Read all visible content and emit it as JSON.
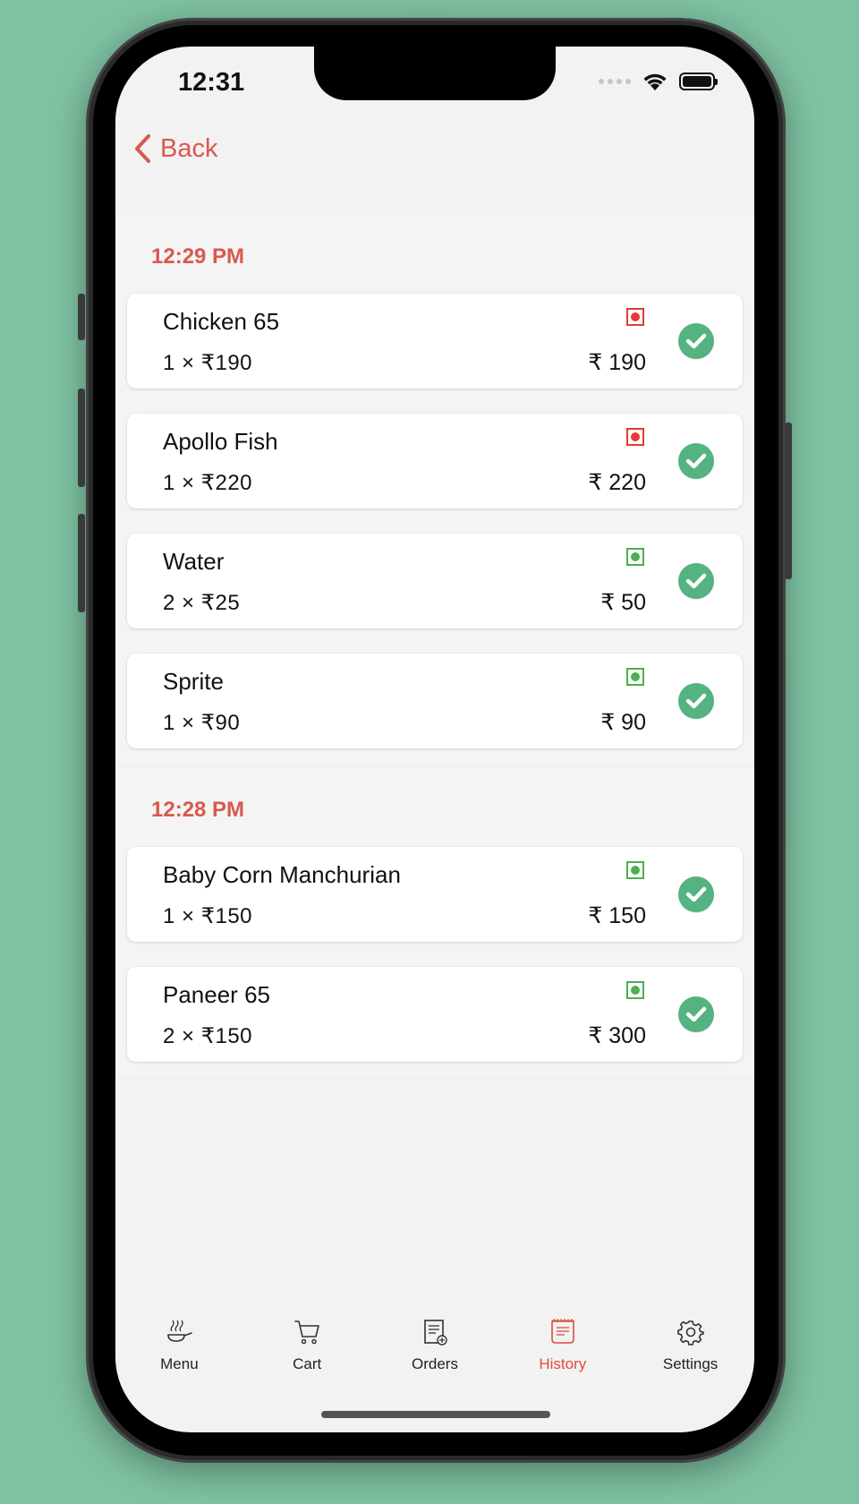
{
  "status_bar": {
    "time": "12:31"
  },
  "nav": {
    "back_label": "Back"
  },
  "sections": [
    {
      "time": "12:29 PM",
      "items": [
        {
          "name": "Chicken 65",
          "qty": "1",
          "unit_price": "₹190",
          "total": "₹ 190",
          "diet": "non-veg",
          "diet_color": "#e53935",
          "completed": true
        },
        {
          "name": "Apollo Fish",
          "qty": "1",
          "unit_price": "₹220",
          "total": "₹ 220",
          "diet": "non-veg",
          "diet_color": "#e53935",
          "completed": true
        },
        {
          "name": "Water",
          "qty": "2",
          "unit_price": "₹25",
          "total": "₹ 50",
          "diet": "veg",
          "diet_color": "#4caf50",
          "completed": true
        },
        {
          "name": "Sprite",
          "qty": "1",
          "unit_price": "₹90",
          "total": "₹ 90",
          "diet": "veg",
          "diet_color": "#4caf50",
          "completed": true
        }
      ]
    },
    {
      "time": "12:28 PM",
      "items": [
        {
          "name": "Baby Corn Manchurian",
          "qty": "1",
          "unit_price": "₹150",
          "total": "₹ 150",
          "diet": "veg",
          "diet_color": "#4caf50",
          "completed": true
        },
        {
          "name": "Paneer 65",
          "qty": "2",
          "unit_price": "₹150",
          "total": "₹ 300",
          "diet": "veg",
          "diet_color": "#4caf50",
          "completed": true
        }
      ]
    }
  ],
  "tabbar": {
    "items": [
      {
        "label": "Menu",
        "icon": "cooking-pan-icon",
        "active": false
      },
      {
        "label": "Cart",
        "icon": "cart-icon",
        "active": false
      },
      {
        "label": "Orders",
        "icon": "orders-icon",
        "active": false
      },
      {
        "label": "History",
        "icon": "receipt-icon",
        "active": true
      },
      {
        "label": "Settings",
        "icon": "gear-icon",
        "active": false
      }
    ]
  },
  "colors": {
    "accent": "#d9584f",
    "active_tab": "#e44a3c",
    "check": "#55b281",
    "veg": "#4caf50",
    "non_veg": "#e53935"
  }
}
